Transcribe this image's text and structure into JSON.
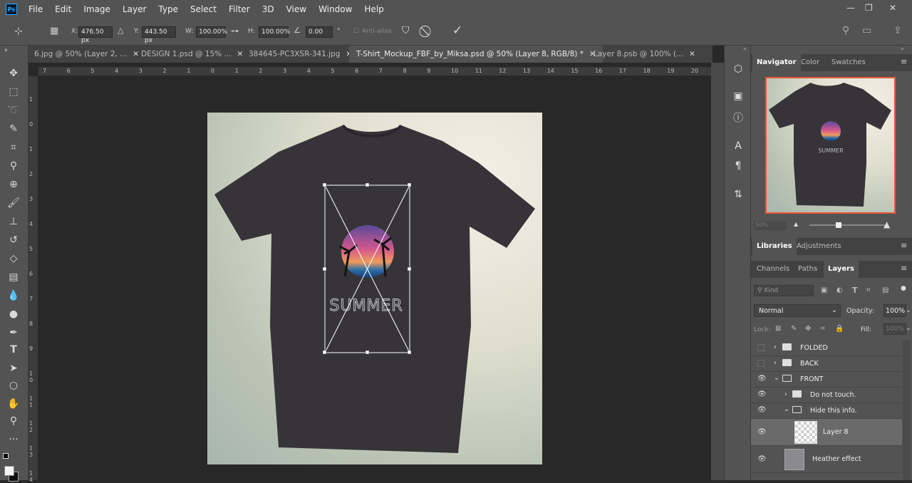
{
  "app": {
    "logo": "Ps"
  },
  "menu": [
    "File",
    "Edit",
    "Image",
    "Layer",
    "Type",
    "Select",
    "Filter",
    "3D",
    "View",
    "Window",
    "Help"
  ],
  "options": {
    "x_label": "X:",
    "x_value": "476.50 px",
    "y_label": "Y:",
    "y_value": "443.50 px",
    "w_label": "W:",
    "w_value": "100.00%",
    "h_label": "H:",
    "h_value": "100.00%",
    "angle_value": "0.00",
    "angle_unit": "°",
    "antialias": "Anti-alias"
  },
  "tabs": [
    {
      "label": "6.jpg @ 50% (Layer 2, ...",
      "active": false
    },
    {
      "label": "DESIGN 1.psd @ 15% ...",
      "active": false
    },
    {
      "label": "384645-PC3XSR-341.jpg",
      "active": false
    },
    {
      "label": "T-Shirt_Mockup_FBF_by_Miksa.psd @ 50% (Layer 8, RGB/8) *",
      "active": true
    },
    {
      "label": "Layer 8.psb @ 100% (...",
      "active": false
    }
  ],
  "ruler_h": [
    "7",
    "6",
    "5",
    "4",
    "3",
    "2",
    "1",
    "0",
    "1",
    "2",
    "3",
    "4",
    "5",
    "6",
    "7",
    "8",
    "9",
    "10",
    "11",
    "12",
    "13",
    "14",
    "15",
    "16",
    "17",
    "18",
    "19",
    "20"
  ],
  "ruler_v": [
    "1",
    "0",
    "1",
    "2",
    "3",
    "4",
    "5",
    "6",
    "7",
    "8",
    "9",
    "1 0",
    "1 1",
    "1 2",
    "1 3",
    "1 4"
  ],
  "canvas": {
    "design_text": "SUMMER"
  },
  "navigator": {
    "tabs": [
      "Navigator",
      "Color",
      "Swatches"
    ],
    "zoom": "50%",
    "thumb_text": "SUMMER"
  },
  "libraries_tabs": [
    "Libraries",
    "Adjustments"
  ],
  "layers_panel": {
    "tabs": [
      "Channels",
      "Paths",
      "Layers"
    ],
    "kind_placeholder": "Kind",
    "blend_mode": "Normal",
    "opacity_label": "Opacity:",
    "opacity_value": "100%",
    "lock_label": "Lock:",
    "fill_label": "Fill:",
    "fill_value": "100%",
    "layers": [
      {
        "name": "FOLDED",
        "visible": false
      },
      {
        "name": "BACK",
        "visible": false
      },
      {
        "name": "FRONT",
        "visible": true
      },
      {
        "name": "Do not touch.",
        "visible": true
      },
      {
        "name": "Hide this info.",
        "visible": true
      },
      {
        "name": "Layer 8",
        "visible": true
      },
      {
        "name": "Heather effect",
        "visible": true
      }
    ]
  },
  "colors": {
    "accent": "#31a8ff",
    "nav_border": "#e8583a",
    "shirt": "#363438"
  }
}
